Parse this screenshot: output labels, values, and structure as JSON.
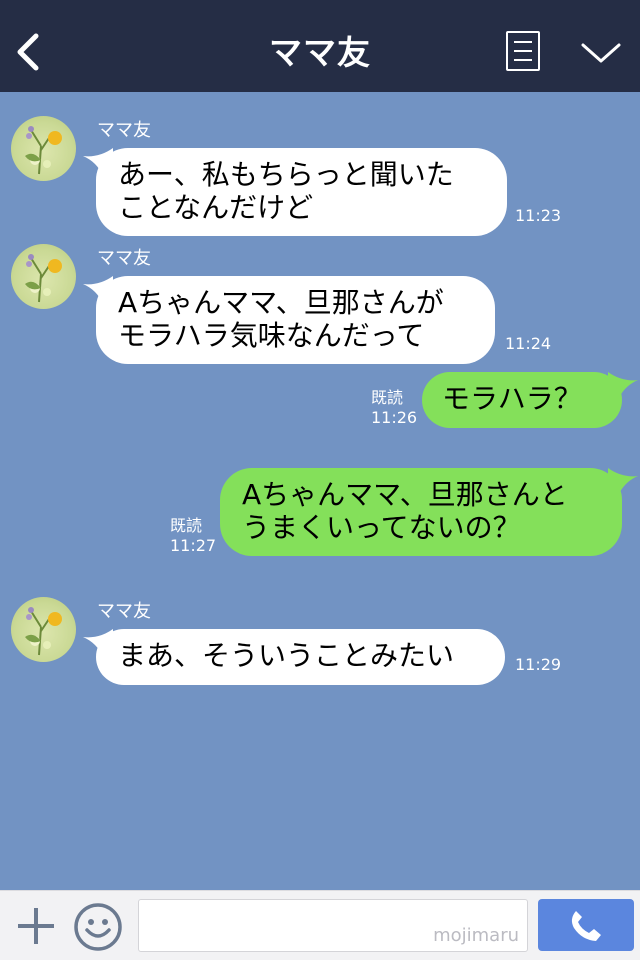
{
  "header": {
    "title": "ママ友",
    "back_icon": "chevron-left-icon",
    "menu_icon": "note-list-icon",
    "collapse_icon": "chevron-down-icon"
  },
  "messages": [
    {
      "direction": "in",
      "sender": "ママ友",
      "lines": [
        "あー、私もちらっと聞いた",
        "ことなんだけど"
      ],
      "time": "11:23"
    },
    {
      "direction": "in",
      "sender": "ママ友",
      "lines": [
        "Aちゃんママ、旦那さんが",
        "モラハラ気味なんだって"
      ],
      "time": "11:24"
    },
    {
      "direction": "out",
      "read": "既読",
      "lines": [
        "モラハラ？"
      ],
      "time": "11:26"
    },
    {
      "direction": "out",
      "read": "既読",
      "lines": [
        "Aちゃんママ、旦那さんと",
        "うまくいってないの？"
      ],
      "time": "11:27"
    },
    {
      "direction": "in",
      "sender": "ママ友",
      "lines": [
        "まあ、そういうことみたい"
      ],
      "time": "11:29"
    }
  ],
  "footer": {
    "watermark": "mojimaru",
    "plus_icon": "plus-icon",
    "emoji_icon": "smiley-icon",
    "call_icon": "phone-icon"
  },
  "colors": {
    "header_bg": "#252d45",
    "chat_bg": "#7293c3",
    "incoming_bubble": "#ffffff",
    "outgoing_bubble": "#84e05a",
    "call_button": "#5b86de"
  }
}
